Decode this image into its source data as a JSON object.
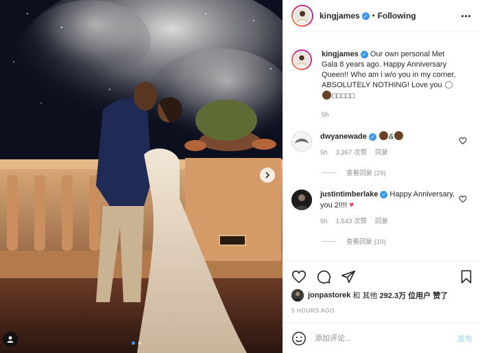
{
  "post": {
    "author": "kingjames",
    "follow_state": "Following",
    "separator": "•",
    "caption": "Our own personal Met Gala 8 years ago. Happy Anniversary Queen!! Who am i w/o you in my corner, ABSOLUTELY NOTHING! Love you",
    "caption_tail": "□□□□□",
    "caption_time": "5h"
  },
  "comments": [
    {
      "user": "dwyanewade",
      "text": "&",
      "time": "5h",
      "likes": "3,267 次赞",
      "reply_label": "回复",
      "view_replies": "查看回复 (29)"
    },
    {
      "user": "justintimberlake",
      "text": "Happy Anniversary, you 2!!!!",
      "time": "5h",
      "likes": "1,543 次赞",
      "reply_label": "回复",
      "view_replies": "查看回复 (10)"
    }
  ],
  "likes_line": {
    "user": "jonpastorek",
    "mid": "和 其他",
    "count": "292.3万",
    "tail": "位用户 赞了"
  },
  "time_ago": "5 HOURS AGO",
  "comment_input": {
    "placeholder": "添加评论...",
    "post_label": "发布"
  },
  "carousel": {
    "slide_count": 2,
    "active_slide": 1
  },
  "colors": {
    "verified": "#3897f0",
    "heart": "#ed4956",
    "post_disabled": "#b2dffc",
    "carousel_active": "#3897f0"
  },
  "icons": [
    "chevron-right-icon",
    "user-tag-icon",
    "more-icon",
    "heart-icon",
    "comment-icon",
    "share-icon",
    "bookmark-icon",
    "emoji-icon",
    "verified-badge-icon"
  ]
}
